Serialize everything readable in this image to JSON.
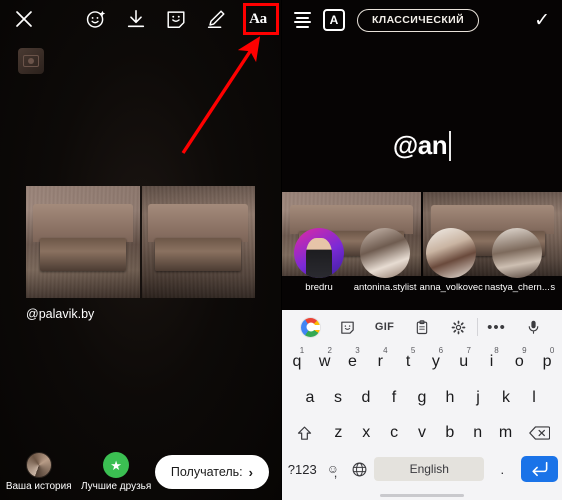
{
  "left_panel": {
    "topbar": {
      "close_icon": "close-x-icon",
      "icons": [
        {
          "name": "effects-sparkle-face-icon",
          "label": "Эффекты"
        },
        {
          "name": "download-icon",
          "label": "Сохранить"
        },
        {
          "name": "sticker-face-icon",
          "label": "Стикер"
        },
        {
          "name": "draw-pen-icon",
          "label": "Рисовать"
        }
      ],
      "text_tool_label": "Aa",
      "text_tool_highlight_color": "#ff0000"
    },
    "gallery_thumb": {
      "icon": "camera-icon"
    },
    "annotation": {
      "arrow_color": "#ff0000",
      "points_to": "Aa"
    },
    "media": {
      "caption": "@palavik.by"
    },
    "bottom_bar": {
      "share_targets": [
        {
          "label": "Ваша история",
          "icon": "story-avatar-icon"
        },
        {
          "label": "Лучшие друзья",
          "icon": "star-icon",
          "color": "#3bbf52"
        }
      ],
      "recipient_label": "Получатель:",
      "recipient_chevron": "chevron-right-icon"
    }
  },
  "right_panel": {
    "topbar": {
      "align_icon": "text-align-icon",
      "background_icon": "A",
      "style_label": "КЛАССИЧЕСКИЙ",
      "done_icon": "checkmark-icon"
    },
    "story_text": {
      "value": "@an",
      "caret": true
    },
    "mention_suggestions": [
      {
        "username": "bredru"
      },
      {
        "username": "antonina.stylist"
      },
      {
        "username": "anna_volkovec"
      },
      {
        "username": "nastya_chern..."
      }
    ],
    "suggestion_overflow": "s",
    "keyboard": {
      "toolbar": [
        {
          "name": "google-logo-icon",
          "label": ""
        },
        {
          "name": "sticker-icon",
          "label": "☺"
        },
        {
          "name": "gif-icon",
          "label": "GIF"
        },
        {
          "name": "clipboard-icon",
          "label": ""
        },
        {
          "name": "settings-gear-icon",
          "label": ""
        },
        {
          "name": "more-options-icon",
          "label": "•••"
        },
        {
          "name": "microphone-icon",
          "label": ""
        }
      ],
      "row1": [
        {
          "key": "q",
          "num": "1"
        },
        {
          "key": "w",
          "num": "2"
        },
        {
          "key": "e",
          "num": "3"
        },
        {
          "key": "r",
          "num": "4"
        },
        {
          "key": "t",
          "num": "5"
        },
        {
          "key": "y",
          "num": "6"
        },
        {
          "key": "u",
          "num": "7"
        },
        {
          "key": "i",
          "num": "8"
        },
        {
          "key": "o",
          "num": "9"
        },
        {
          "key": "p",
          "num": "0"
        }
      ],
      "row2": [
        {
          "key": "a"
        },
        {
          "key": "s"
        },
        {
          "key": "d"
        },
        {
          "key": "f"
        },
        {
          "key": "g"
        },
        {
          "key": "h"
        },
        {
          "key": "j"
        },
        {
          "key": "k"
        },
        {
          "key": "l"
        }
      ],
      "row3_shift": "shift-icon",
      "row3": [
        {
          "key": "z"
        },
        {
          "key": "x"
        },
        {
          "key": "c"
        },
        {
          "key": "v"
        },
        {
          "key": "b"
        },
        {
          "key": "n"
        },
        {
          "key": "m"
        }
      ],
      "row3_backspace": "backspace-icon",
      "row4": {
        "symbols_label": "?123",
        "emoji_icon": "emoji-icon",
        "comma": ",",
        "language_icon": "globe-icon",
        "space_label": "English",
        "period": ".",
        "enter_icon": "enter-icon",
        "enter_color": "#1a73e8"
      }
    }
  }
}
